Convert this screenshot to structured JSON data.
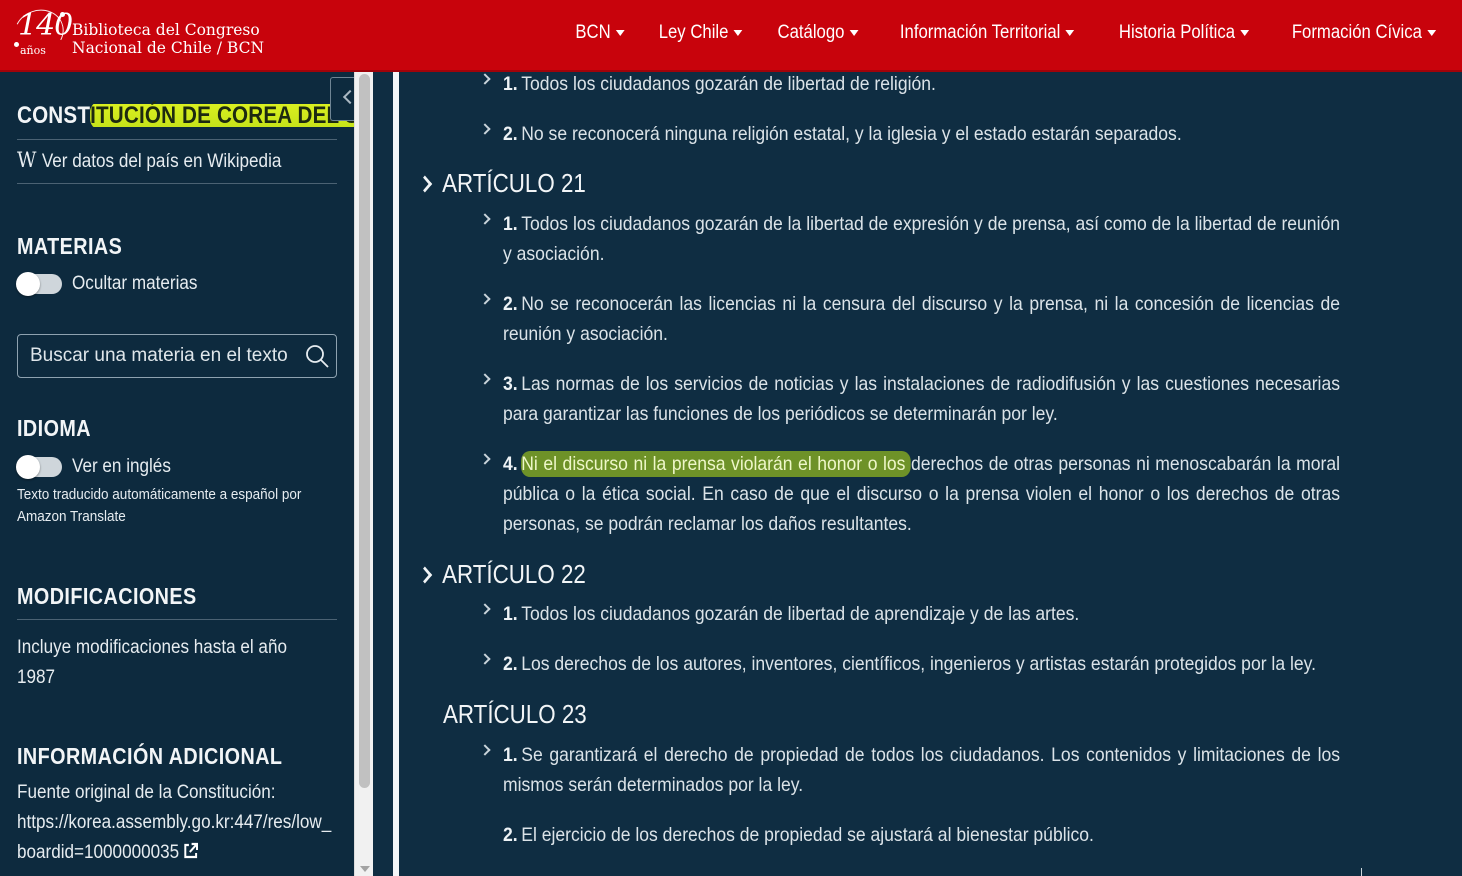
{
  "header": {
    "logo": {
      "number": "140",
      "anos": "años",
      "line1": "Biblioteca del Congreso",
      "line2": "Nacional de Chile / BCN"
    },
    "menu": [
      "BCN",
      "Ley Chile",
      "Catálogo",
      "Información Territorial",
      "Historia Política",
      "Formación Cívica"
    ],
    "brand_color": "#c8030c"
  },
  "sidebar": {
    "title_pre": "CONST",
    "title_hl": "ITUCIÓN DE COREA DEL SU",
    "title_post": "R",
    "wiki_label": "Ver datos del país en Wikipedia",
    "materias_heading": "MATERIAS",
    "hide_materias_label": "Ocultar materias",
    "search_placeholder": "Buscar una materia en el texto",
    "idioma_heading": "IDIOMA",
    "english_label": "Ver en inglés",
    "translation_note": "Texto traducido automáticamente a español por",
    "translation_provider": "Amazon Translate",
    "modificaciones_heading": "MODIFICACIONES",
    "modificaciones_text_1": "Incluye modificaciones hasta el año",
    "modificaciones_year": "1987",
    "info_heading": "INFORMACIÓN ADICIONAL",
    "fuente_label": "Fuente original de la Constitución:",
    "fuente_url_1": "https://korea.assembly.go.kr:447/res/low_",
    "fuente_url_2": "boardid=1000000035"
  },
  "content": {
    "top_item_1": {
      "num": "1.",
      "text": "Todos los ciudadanos gozarán de libertad de religión."
    },
    "top_item_2": {
      "num": "2.",
      "text": "No se reconocerá ninguna religión estatal, y la iglesia y el estado estarán separados."
    },
    "art21": {
      "title": "ARTÍCULO 21",
      "items": [
        {
          "num": "1.",
          "text": "Todos los ciudadanos gozarán de la libertad de expresión y de prensa, así como de la libertad de reunión y asociación."
        },
        {
          "num": "2.",
          "text": "No se reconocerán las licencias ni la censura del discurso y la prensa, ni la concesión de licencias de reunión y asociación."
        },
        {
          "num": "3.",
          "text": "Las normas de los servicios de noticias y las instalaciones de radiodifusión y las cuestiones necesarias para garantizar las funciones de los periódicos se determinarán por ley."
        },
        {
          "num": "4.",
          "hl": "Ni el discurso ni la prensa violarán el honor o los ",
          "text": "derechos de otras personas ni menoscabarán la moral pública o la ética social. En caso de que el discurso o la prensa violen el honor o los derechos de otras personas, se podrán reclamar los daños resultantes."
        }
      ]
    },
    "art22": {
      "title": "ARTÍCULO 22",
      "items": [
        {
          "num": "1.",
          "text": "Todos los ciudadanos gozarán de libertad de aprendizaje y de las artes."
        },
        {
          "num": "2.",
          "text": "Los derechos de los autores, inventores, científicos, ingenieros y artistas estarán protegidos por la ley."
        }
      ]
    },
    "art23": {
      "title": "ARTÍCULO 23",
      "items": [
        {
          "num": "1.",
          "text": "Se garantizará el derecho de propiedad de todos los ciudadanos. Los contenidos y limitaciones de los mismos serán determinados por la ley."
        },
        {
          "num": "2.",
          "text": "El ejercicio de los derechos de propiedad se ajustará al bienestar público."
        }
      ]
    }
  }
}
